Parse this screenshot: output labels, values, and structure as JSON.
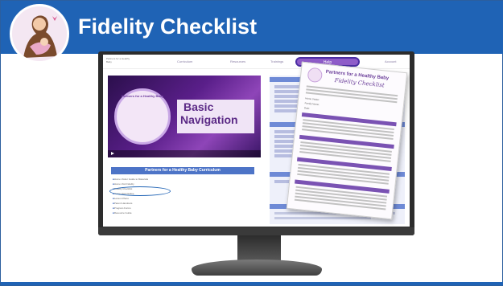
{
  "slide": {
    "title": "Fidelity Checklist",
    "colors": {
      "title_bar": "#1f63b5",
      "accent_purple": "#7a52b3"
    }
  },
  "screen": {
    "nav": {
      "brand": "Partners for a Healthy Baby",
      "items": [
        "Curriculum",
        "Resources",
        "Trainings",
        "Help",
        "Account"
      ],
      "active_item": "Help"
    },
    "video": {
      "ring_text": "Partners for a Healthy Baby",
      "title_line1": "Basic",
      "title_line2": "Navigation"
    },
    "curriculum": {
      "header": "Partners for a Healthy Baby Curriculum",
      "items": [
        "Home Visitor Guide to Materials",
        "Home Visit Fidelity",
        "Fidelity Checklist",
        "Home Visit Outline",
        "Lesson Plans",
        "Parent Handouts",
        "Program Forms",
        "Resource Guide"
      ],
      "highlighted_item": "Fidelity Checklist"
    }
  },
  "document": {
    "title_line1": "Partners for a Healthy Baby",
    "title_line2": "Fidelity Checklist",
    "fields": [
      "Home Visitor:",
      "Family Name:",
      "Date:"
    ]
  }
}
